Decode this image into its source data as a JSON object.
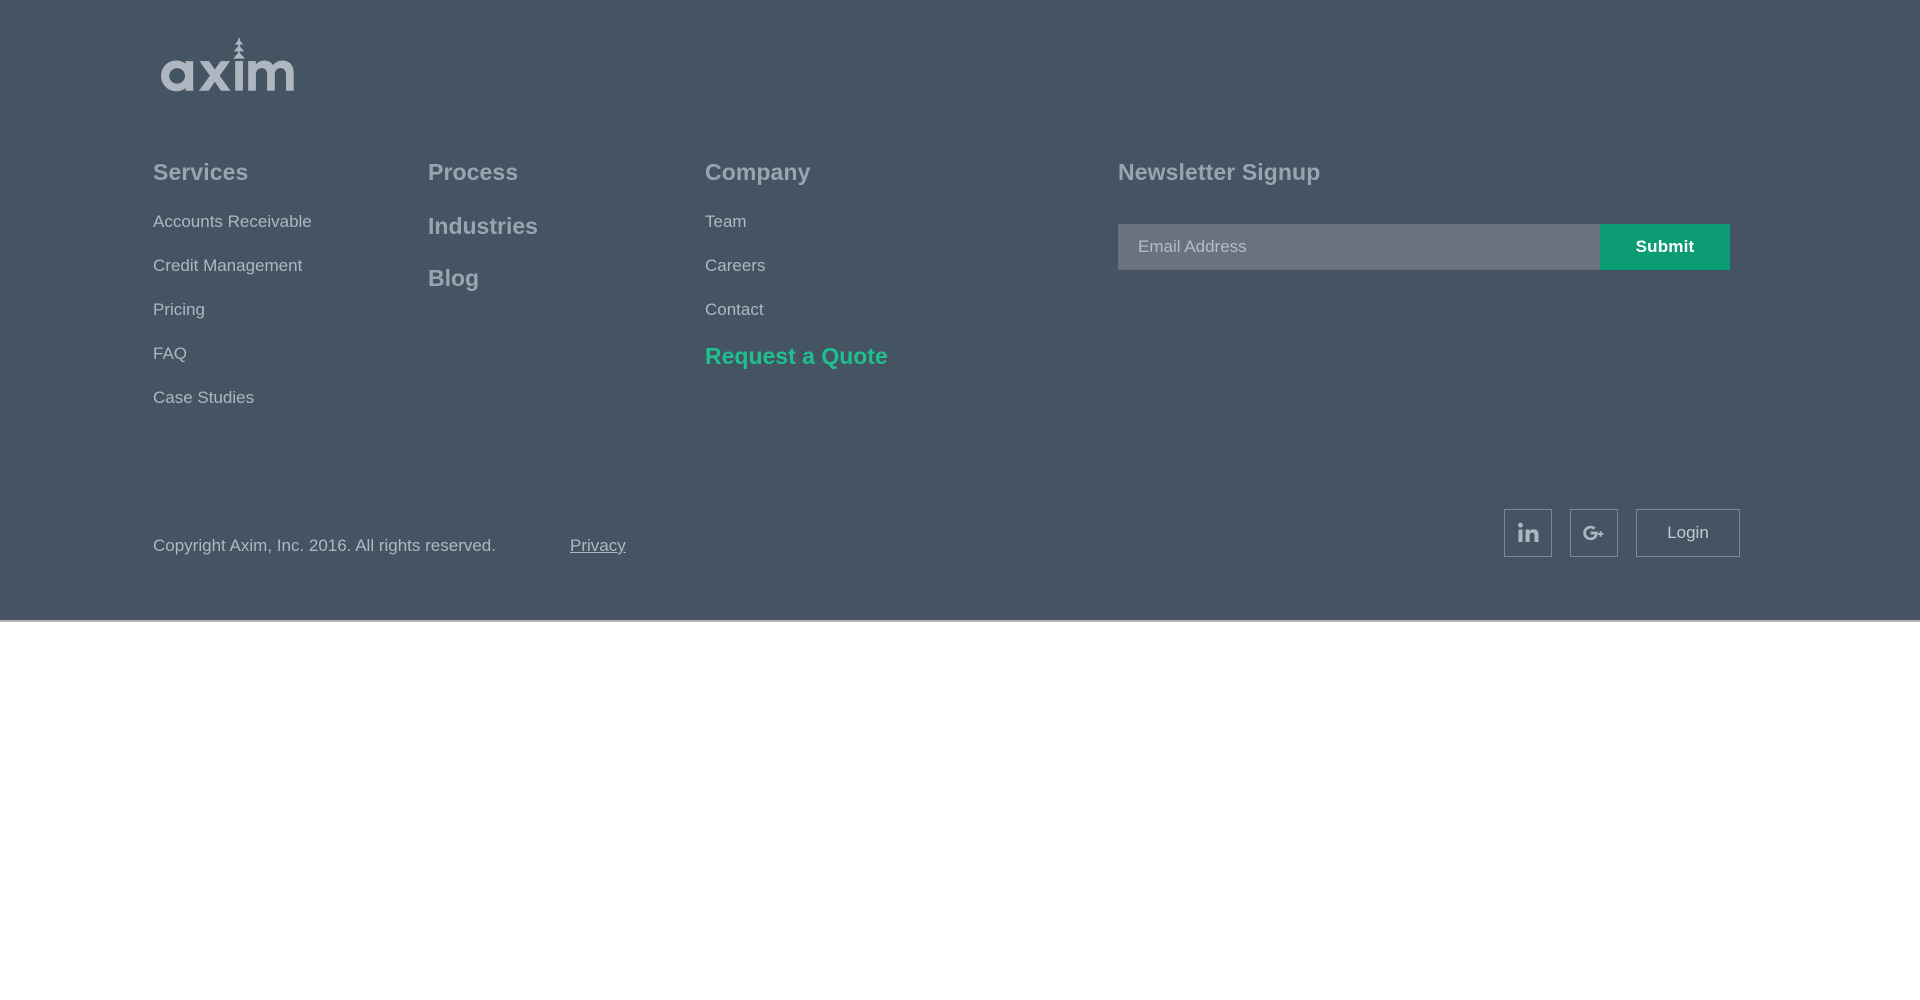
{
  "theme": {
    "footer_bg": "#455463",
    "accent_green": "#1fbf8f",
    "submit_green": "#0b9c74",
    "input_bg": "#6a7280",
    "text_muted": "#aeb6c0",
    "heading_color": "#9aa4b0"
  },
  "logo": {
    "text": "axim",
    "icon": "tree-ornament-icon"
  },
  "columns": {
    "services": {
      "title": "Services",
      "links": [
        "Accounts Receivable",
        "Credit Management",
        "Pricing",
        "FAQ",
        "Case Studies"
      ]
    },
    "process": {
      "title": "Process",
      "links": [
        "Industries",
        "Blog"
      ]
    },
    "company": {
      "title": "Company",
      "links": [
        "Team",
        "Careers",
        "Contact"
      ],
      "cta": "Request a Quote"
    }
  },
  "newsletter": {
    "title": "Newsletter Signup",
    "email_value": "",
    "email_placeholder": "Email Address",
    "submit_label": "Submit"
  },
  "bottom": {
    "copyright": "Copyright Axim, Inc. 2016.  All rights reserved.",
    "privacy_label": "Privacy",
    "social": [
      {
        "name": "linkedin-icon",
        "label": "in"
      },
      {
        "name": "google-plus-icon",
        "label": "G+"
      }
    ],
    "login_label": "Login"
  }
}
